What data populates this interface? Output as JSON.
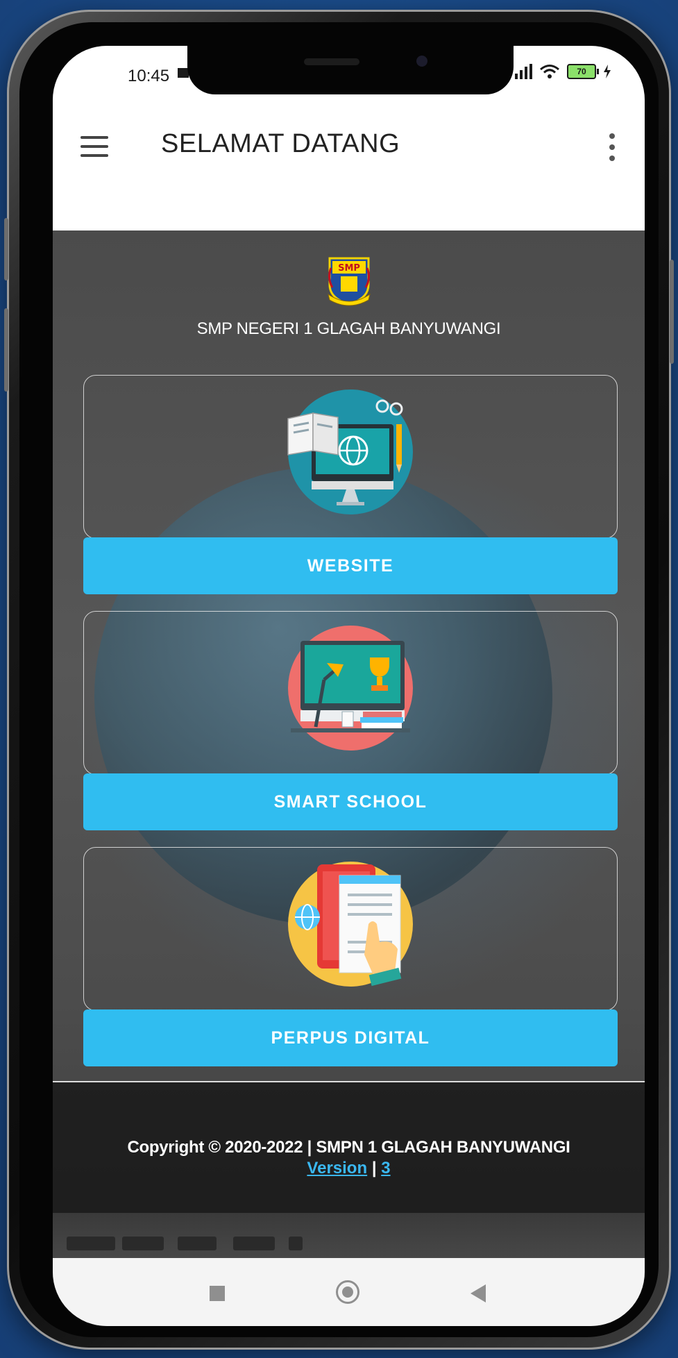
{
  "status_bar": {
    "time": "10:45",
    "battery": "70"
  },
  "app_bar": {
    "title": "SELAMAT DATANG"
  },
  "header": {
    "school_name": "SMP NEGERI 1 GLAGAH BANYUWANGI",
    "logo_text": "SMP"
  },
  "menu": [
    {
      "label": "WEBSITE",
      "icon": "computer-globe-icon"
    },
    {
      "label": "SMART SCHOOL",
      "icon": "desk-trophy-icon"
    },
    {
      "label": "PERPUS DIGITAL",
      "icon": "tablet-ebook-icon"
    }
  ],
  "footer": {
    "copyright": "Copyright © 2020-2022 | SMPN 1 GLAGAH BANYUWANGI",
    "version_label": "Version",
    "separator": "|",
    "version_number": "3"
  },
  "colors": {
    "accent": "#30bdf0",
    "background": "#1c4f8f",
    "app_bar": "#ffffff"
  }
}
